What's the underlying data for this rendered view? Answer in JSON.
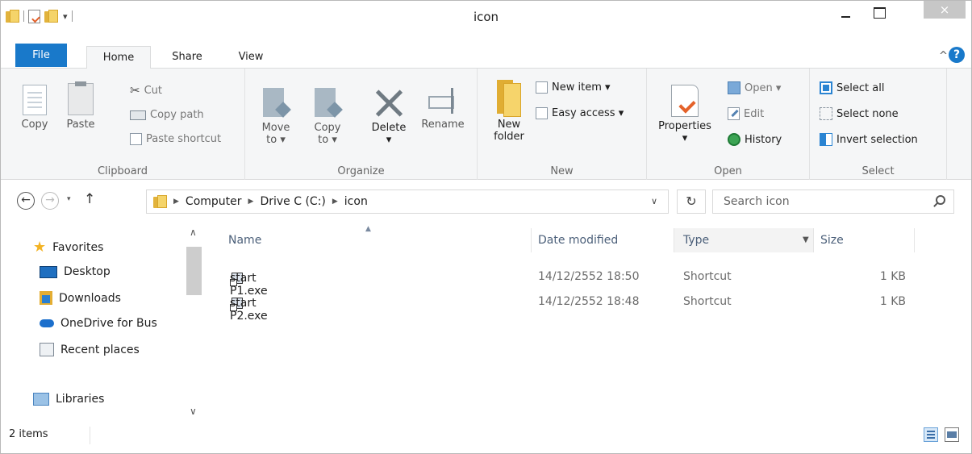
{
  "window": {
    "title": "icon"
  },
  "title_bar": {
    "close_glyph": "×"
  },
  "ribbon_tabs": [
    {
      "label": "File"
    },
    {
      "label": "Home"
    },
    {
      "label": "Share"
    },
    {
      "label": "View"
    }
  ],
  "ribbon": {
    "clipboard": {
      "label": "Clipboard",
      "copy": "Copy",
      "paste": "Paste",
      "cut": "Cut",
      "copy_path": "Copy path",
      "paste_shortcut": "Paste shortcut"
    },
    "organize": {
      "label": "Organize",
      "move_to_line1": "Move",
      "move_to_line2": "to ▾",
      "copy_to_line1": "Copy",
      "copy_to_line2": "to ▾",
      "delete": "Delete",
      "delete_arrow": "▾",
      "rename": "Rename"
    },
    "new": {
      "label": "New",
      "new_folder_line1": "New",
      "new_folder_line2": "folder",
      "new_item": "New item ▾",
      "easy_access": "Easy access ▾"
    },
    "open": {
      "label": "Open",
      "properties": "Properties",
      "properties_arrow": "▾",
      "open": "Open ▾",
      "edit": "Edit",
      "history": "History"
    },
    "select": {
      "label": "Select",
      "select_all": "Select all",
      "select_none": "Select none",
      "invert_selection": "Invert selection"
    }
  },
  "address": {
    "crumbs": [
      "Computer",
      "Drive C (C:)",
      "icon"
    ],
    "search_placeholder": "Search icon"
  },
  "nav_pane": {
    "favorites": "Favorites",
    "items": [
      "Desktop",
      "Downloads",
      "OneDrive for Bus",
      "Recent places"
    ],
    "libraries": "Libraries"
  },
  "columns": {
    "name": "Name",
    "date": "Date modified",
    "type": "Type",
    "size": "Size"
  },
  "files": [
    {
      "name": "start P1.exe",
      "date": "14/12/2552 18:50",
      "type": "Shortcut",
      "size": "1 KB"
    },
    {
      "name": "start P2.exe",
      "date": "14/12/2552 18:48",
      "type": "Shortcut",
      "size": "1 KB"
    }
  ],
  "status": {
    "count": "2 items"
  }
}
